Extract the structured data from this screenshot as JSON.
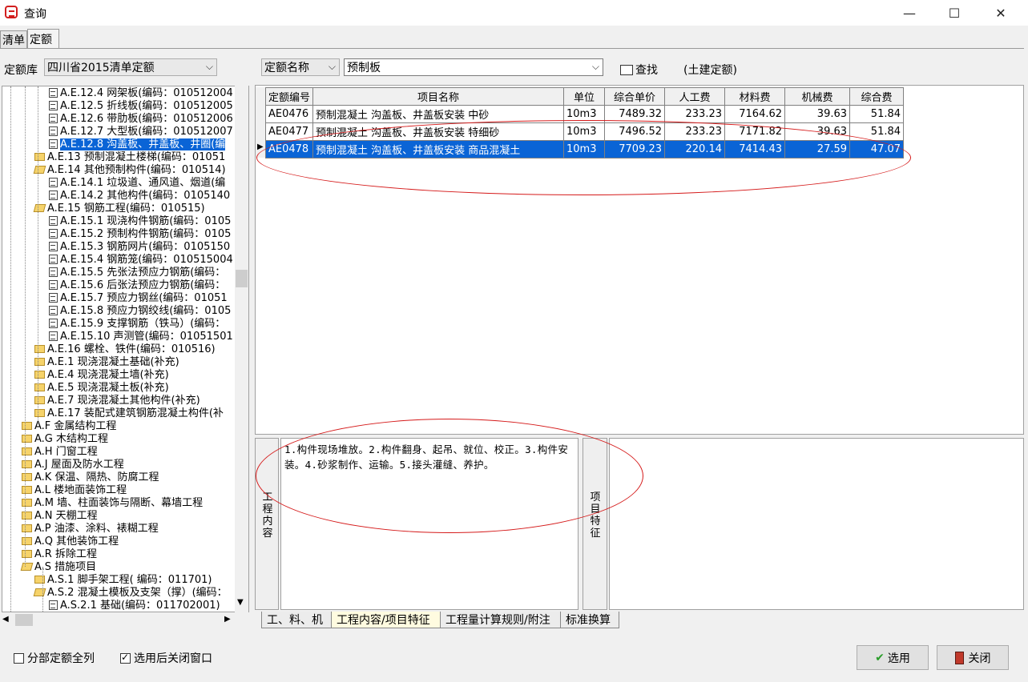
{
  "window": {
    "title": "查询",
    "minimize": "—",
    "maximize": "☐",
    "close": "✕"
  },
  "tabs": {
    "qingdan": "清单",
    "dinge": "定额"
  },
  "left_toolbar": {
    "library_label": "定额库",
    "library_value": "四川省2015清单定额"
  },
  "search": {
    "field_select": "定额名称",
    "query_value": "预制板",
    "find_label": "查找",
    "category": "(土建定额)"
  },
  "tree": [
    {
      "label": "A.E.12.4 网架板(编码：010512004",
      "type": "doc"
    },
    {
      "label": "A.E.12.5 折线板(编码：010512005",
      "type": "doc"
    },
    {
      "label": "A.E.12.6 带肋板(编码：010512006",
      "type": "doc"
    },
    {
      "label": "A.E.12.7 大型板(编码：010512007",
      "type": "doc"
    },
    {
      "label": "A.E.12.8 沟盖板、井盖板、井圈(编",
      "type": "doc",
      "selected": true
    },
    {
      "label": "A.E.13 预制混凝土楼梯(编码：01051",
      "type": "folder"
    },
    {
      "label": "A.E.14 其他预制构件(编码：010514)",
      "type": "folder-open"
    },
    {
      "label": "A.E.14.1 垃圾道、通风道、烟道(编",
      "type": "doc"
    },
    {
      "label": "A.E.14.2 其他构件(编码：0105140",
      "type": "doc"
    },
    {
      "label": "A.E.15 钢筋工程(编码：010515)",
      "type": "folder-open"
    },
    {
      "label": "A.E.15.1 现浇构件钢筋(编码：0105",
      "type": "doc"
    },
    {
      "label": "A.E.15.2 预制构件钢筋(编码：0105",
      "type": "doc"
    },
    {
      "label": "A.E.15.3 钢筋网片(编码：0105150",
      "type": "doc"
    },
    {
      "label": "A.E.15.4 钢筋笼(编码：010515004",
      "type": "doc"
    },
    {
      "label": "A.E.15.5 先张法预应力钢筋(编码：",
      "type": "doc"
    },
    {
      "label": "A.E.15.6 后张法预应力钢筋(编码：",
      "type": "doc"
    },
    {
      "label": "A.E.15.7 预应力钢丝(编码：01051",
      "type": "doc"
    },
    {
      "label": "A.E.15.8 预应力钢绞线(编码：0105",
      "type": "doc"
    },
    {
      "label": "A.E.15.9 支撑钢筋（铁马）(编码：",
      "type": "doc"
    },
    {
      "label": "A.E.15.10 声测管(编码：01051501",
      "type": "doc"
    },
    {
      "label": "A.E.16 螺栓、铁件(编码：010516)",
      "type": "folder"
    },
    {
      "label": "A.E.1 现浇混凝土基础(补充)",
      "type": "folder"
    },
    {
      "label": "A.E.4 现浇混凝土墙(补充)",
      "type": "folder"
    },
    {
      "label": "A.E.5 现浇混凝土板(补充)",
      "type": "folder"
    },
    {
      "label": "A.E.7 现浇混凝土其他构件(补充)",
      "type": "folder"
    },
    {
      "label": "A.E.17 装配式建筑钢筋混凝土构件(补",
      "type": "folder"
    },
    {
      "label": "A.F 金属结构工程",
      "type": "folder"
    },
    {
      "label": "A.G 木结构工程",
      "type": "folder"
    },
    {
      "label": "A.H 门窗工程",
      "type": "folder"
    },
    {
      "label": "A.J 屋面及防水工程",
      "type": "folder"
    },
    {
      "label": "A.K 保温、隔热、防腐工程",
      "type": "folder"
    },
    {
      "label": "A.L 楼地面装饰工程",
      "type": "folder"
    },
    {
      "label": "A.M 墙、柱面装饰与隔断、幕墙工程",
      "type": "folder"
    },
    {
      "label": "A.N 天棚工程",
      "type": "folder"
    },
    {
      "label": "A.P 油漆、涂料、裱糊工程",
      "type": "folder"
    },
    {
      "label": "A.Q 其他装饰工程",
      "type": "folder"
    },
    {
      "label": "A.R 拆除工程",
      "type": "folder"
    },
    {
      "label": "A.S 措施项目",
      "type": "folder-open"
    },
    {
      "label": "A.S.1 脚手架工程( 编码：011701)",
      "type": "folder"
    },
    {
      "label": "A.S.2 混凝土模板及支架（撑）(编码：",
      "type": "folder-open"
    },
    {
      "label": "A.S.2.1 基础(编码：011702001)",
      "type": "doc"
    }
  ],
  "grid": {
    "columns": [
      "定额编号",
      "项目名称",
      "单位",
      "综合单价",
      "人工费",
      "材料费",
      "机械费",
      "综合费"
    ],
    "rows": [
      [
        "AE0476",
        "预制混凝土 沟盖板、井盖板安装 中砂",
        "10m3",
        "7489.32",
        "233.23",
        "7164.62",
        "39.63",
        "51.84"
      ],
      [
        "AE0477",
        "预制混凝土 沟盖板、井盖板安装 特细砂",
        "10m3",
        "7496.52",
        "233.23",
        "7171.82",
        "39.63",
        "51.84"
      ],
      [
        "AE0478",
        "预制混凝土 沟盖板、井盖板安装 商品混凝土",
        "10m3",
        "7709.23",
        "220.14",
        "7414.43",
        "27.59",
        "47.07"
      ]
    ]
  },
  "work_content": {
    "label": "工程内容",
    "text": "1.构件现场堆放。2.构件翻身、起吊、就位、校正。3.构件安装。4.砂浆制作、运输。5.接头灌缝、养护。"
  },
  "features": {
    "label": "项目特征",
    "text": ""
  },
  "bottom_tabs": [
    "工、料、机",
    "工程内容/项目特征",
    "工程量计算规则/附注",
    "标准换算"
  ],
  "options": {
    "show_all": "分部定额全列",
    "close_after_select": "选用后关闭窗口"
  },
  "buttons": {
    "select": "选用",
    "close": "关闭"
  },
  "colors": {
    "selection": "#0a64d6",
    "annotation": "#d51a1a"
  }
}
